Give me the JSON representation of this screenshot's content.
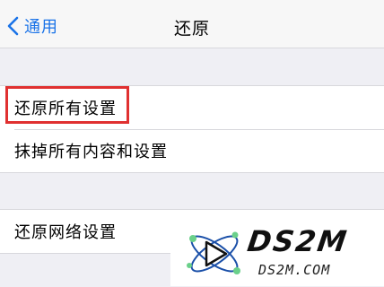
{
  "navbar": {
    "back_label": "通用",
    "title": "还原"
  },
  "groups": {
    "reset": {
      "items": [
        {
          "label": "还原所有设置"
        },
        {
          "label": "抹掉所有内容和设置"
        }
      ]
    },
    "network": {
      "items": [
        {
          "label": "还原网络设置"
        }
      ]
    }
  },
  "watermark": {
    "logo_text": "DS2M",
    "url_text": "DS2M.COM"
  },
  "colors": {
    "accent": "#1a73e8",
    "highlight_border": "#e03030",
    "background": "#efeff4",
    "cell_background": "#ffffff"
  },
  "icons": {
    "back": "chevron-left-icon",
    "watermark_logo": "atom-play-logo-icon"
  }
}
